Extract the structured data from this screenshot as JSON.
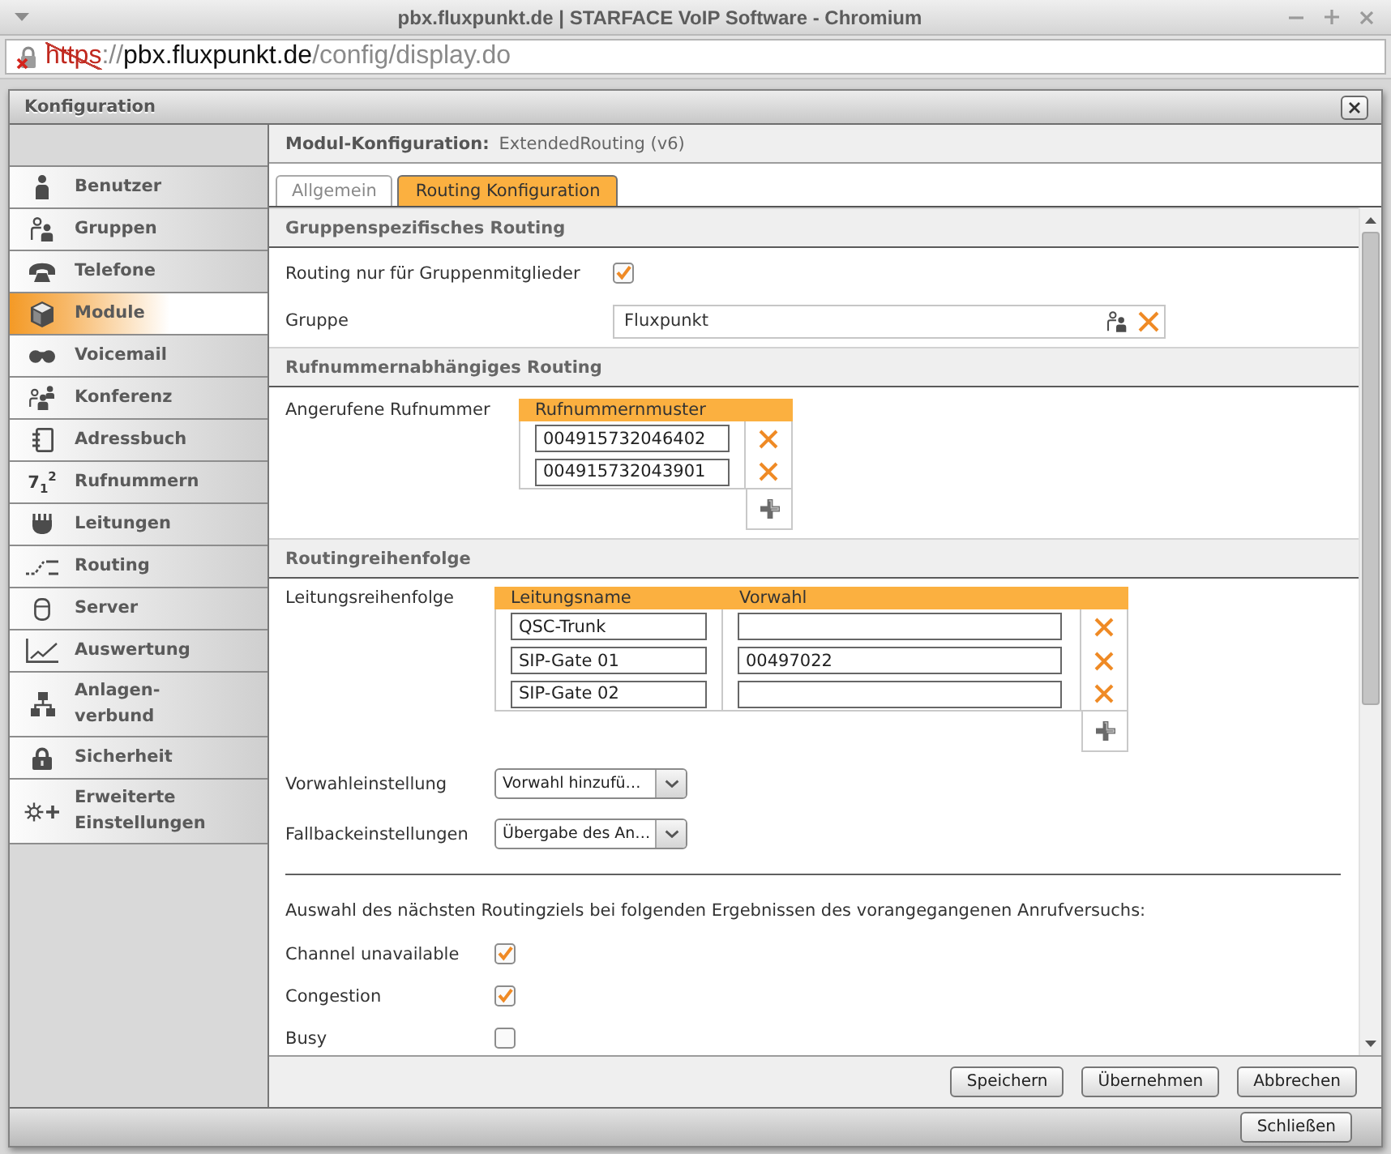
{
  "browser": {
    "title": "pbx.fluxpunkt.de | STARFACE VoIP Software - Chromium",
    "url": {
      "secure": false,
      "scheme": "https",
      "separator": "://",
      "host": "pbx.fluxpunkt.de",
      "path": "/config/display.do"
    }
  },
  "dialog": {
    "title": "Konfiguration"
  },
  "sidebar": {
    "items": [
      {
        "label": "Benutzer",
        "selected": false
      },
      {
        "label": "Gruppen",
        "selected": false
      },
      {
        "label": "Telefone",
        "selected": false
      },
      {
        "label": "Module",
        "selected": true
      },
      {
        "label": "Voicemail",
        "selected": false
      },
      {
        "label": "Konferenz",
        "selected": false
      },
      {
        "label": "Adressbuch",
        "selected": false
      },
      {
        "label": "Rufnummern",
        "glyph": "7$_{1}$$^{2}$",
        "selected": false
      },
      {
        "label": "Leitungen",
        "selected": false
      },
      {
        "label": "Routing",
        "selected": false
      },
      {
        "label": "Server",
        "selected": false
      },
      {
        "label": "Auswertung",
        "selected": false
      },
      {
        "label": "Anlagen-verbund",
        "selected": false
      },
      {
        "label": "Sicherheit",
        "selected": false
      },
      {
        "label": "Erweiterte Einstellungen",
        "selected": false
      }
    ]
  },
  "module_header": {
    "label": "Modul-Konfiguration:",
    "value": "ExtendedRouting (v6)"
  },
  "tabs": [
    {
      "label": "Allgemein",
      "selected": false
    },
    {
      "label": "Routing Konfiguration",
      "selected": true
    }
  ],
  "sections": [
    {
      "title": "Gruppenspezifisches Routing",
      "rows": [
        {
          "kind": "checkbox",
          "label": "Routing nur für Gruppenmitglieder",
          "checked": true
        },
        {
          "kind": "picker",
          "label": "Gruppe",
          "value": "Fluxpunkt"
        }
      ]
    },
    {
      "title": "Rufnummernabhängiges Routing",
      "rows": [
        {
          "kind": "pattern_table",
          "label": "Angerufene Rufnummer",
          "columns": [
            "Rufnummernmuster"
          ],
          "rows": [
            {
              "pattern": "004915732046402"
            },
            {
              "pattern": "004915732043901"
            }
          ]
        }
      ]
    },
    {
      "title": "Routingreihenfolge",
      "rows": [
        {
          "kind": "line_table",
          "label": "Leitungsreihenfolge",
          "columns": [
            "Leitungsname",
            "Vorwahl"
          ],
          "rows": [
            {
              "line": "QSC-Trunk"
            },
            {
              "line": "SIP-Gate 01",
              "prefix": "00497022"
            },
            {
              "line": "SIP-Gate 02"
            }
          ]
        },
        {
          "kind": "select",
          "label": "Vorwahleinstellung",
          "value": "Vorwahl hinzufü…"
        },
        {
          "kind": "select",
          "label": "Fallbackeinstellungen",
          "value": "Übergabe des An…"
        },
        {
          "kind": "divider"
        },
        {
          "kind": "note",
          "text": "Auswahl des nächsten Routingziels bei folgenden Ergebnissen des vorangegangenen Anrufversuchs:"
        },
        {
          "kind": "checkbox",
          "label": "Channel unavailable",
          "checked": true
        },
        {
          "kind": "checkbox",
          "label": "Congestion",
          "checked": true
        },
        {
          "kind": "checkbox",
          "label": "Busy",
          "checked": false
        }
      ]
    }
  ],
  "buttons": [
    "Speichern",
    "Übernehmen",
    "Abbrechen"
  ],
  "footer": {
    "button": "Schließen"
  }
}
